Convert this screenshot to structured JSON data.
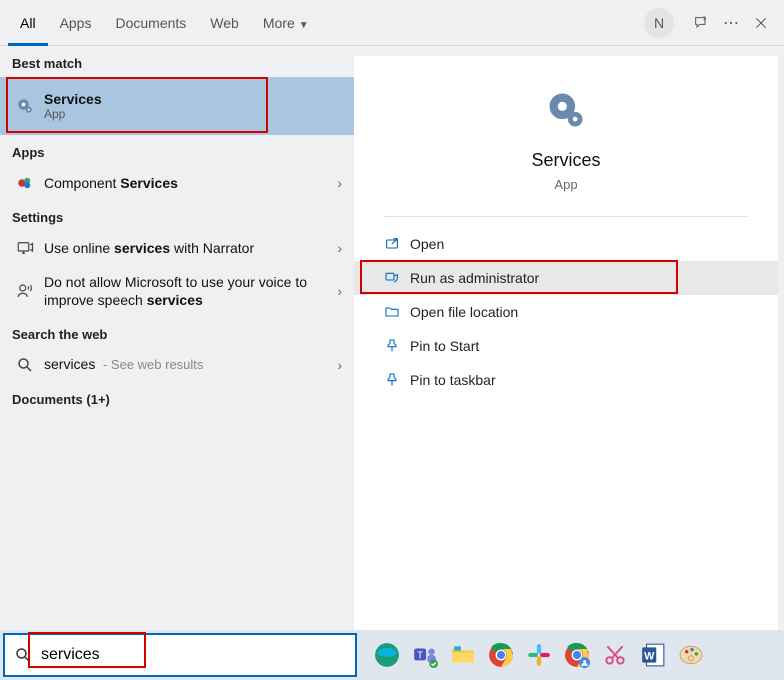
{
  "tabs": {
    "all": "All",
    "apps": "Apps",
    "documents": "Documents",
    "web": "Web",
    "more": "More"
  },
  "avatar_initial": "N",
  "left": {
    "best_match_h": "Best match",
    "best": {
      "title": "Services",
      "sub": "App"
    },
    "apps_h": "Apps",
    "component_pre": "Component ",
    "component_bold": "Services",
    "settings_h": "Settings",
    "narrator_pre": "Use online ",
    "narrator_bold": "services",
    "narrator_post": " with Narrator",
    "speech_pre": "Do not allow Microsoft to use your voice to improve speech ",
    "speech_bold": "services",
    "web_h": "Search the web",
    "web_term": "services",
    "web_meta": " - See web results",
    "docs_h": "Documents (1+)"
  },
  "preview": {
    "title": "Services",
    "sub": "App",
    "open": "Open",
    "admin": "Run as administrator",
    "loc": "Open file location",
    "pin_start": "Pin to Start",
    "pin_task": "Pin to taskbar"
  },
  "search": {
    "value": "services"
  }
}
